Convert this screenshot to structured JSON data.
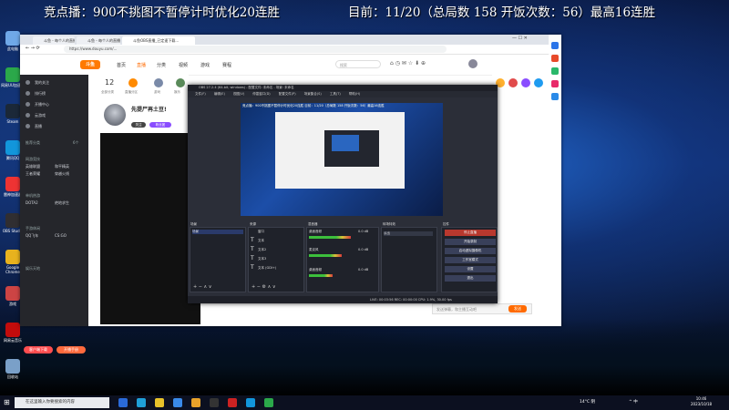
{
  "banner": {
    "left": "竞点播：900不挑图不暂停计时优化20连胜",
    "right": "目前：11/20（总局数 158 开饭次数：56）最高16连胜"
  },
  "desktop_icons": [
    {
      "label": "此电脑",
      "color": "#6fa8e8"
    },
    {
      "label": "网易UU加速器",
      "color": "#2ba84a"
    },
    {
      "label": "Steam",
      "color": "#1b2838"
    },
    {
      "label": "腾讯QQ",
      "color": "#1296db"
    },
    {
      "label": "雷神加速器",
      "color": "#e33"
    },
    {
      "label": "OBS Studio",
      "color": "#302e31"
    },
    {
      "label": "Google Chrome",
      "color": "#e8b21e"
    },
    {
      "label": "游戏",
      "color": "#c44"
    },
    {
      "label": "网易云音乐",
      "color": "#c20c0c"
    },
    {
      "label": "回收站",
      "color": "#7aa0c8"
    }
  ],
  "browser": {
    "tabs": [
      "斗鱼 - 每个人的直播平台",
      "斗鱼 - 每个人的直播平台",
      "斗鱼OBS直播_已定速下载..."
    ],
    "url": "https://www.douyu.com/...",
    "logo": "斗鱼",
    "nav": [
      "首页",
      "直播",
      "分类",
      "视频",
      "游戏",
      "赛程"
    ],
    "active_nav": "直播",
    "search_placeholder": "搜索",
    "window_controls": "—   ☐   ✕",
    "sidebar": {
      "items": [
        "我的关注",
        "排行榜",
        "开播中心",
        "云游戏",
        "直播"
      ],
      "sections": [
        {
          "title": "推荐分类",
          "count": "6个"
        },
        {
          "title": "网游竞技",
          "count": ""
        },
        {
          "title": "单机热游",
          "count": ""
        },
        {
          "title": "手游休闲",
          "count": ""
        },
        {
          "title": "娱乐天地",
          "count": ""
        }
      ],
      "games": [
        "英雄联盟",
        "和平精英",
        "王者荣耀",
        "穿越火线",
        "DOTA2",
        "绝地求生",
        "QQ飞车",
        "CS:GO"
      ],
      "btn_left": "客户端下载",
      "btn_right": "开播手册"
    },
    "categories": {
      "num": "12",
      "labels": [
        "全部分类",
        "直播分区",
        "游戏",
        "娱乐"
      ]
    },
    "streamer": {
      "name": "先提尸再土豆!",
      "badge1": "关注",
      "badge2": "粉丝团"
    },
    "chat_placeholder": "发送弹幕，和主播互动吧",
    "send": "发送"
  },
  "obs": {
    "title": "OBS 27.2.4 (64-bit, windows) - 配置文件: 未命名 - 场景: 未命名",
    "menu": [
      "文件(F)",
      "编辑(E)",
      "视图(V)",
      "停靠窗口(D)",
      "配置文件(P)",
      "场景集合(S)",
      "工具(T)",
      "帮助(H)"
    ],
    "preview_text": "竞点播：900不挑图不暂停计时优化20连胜    目前：11/20（总局数 158 开饭次数：56）最高16连胜",
    "docks": {
      "scenes": "场景",
      "sources": "来源",
      "mixer": "混音器",
      "transitions": "转场特效",
      "controls": "控件"
    },
    "scene_items": [
      "场景"
    ],
    "source_items": [
      "窗口",
      "文本",
      "文本2",
      "文本3",
      "文本 (GDI+)"
    ],
    "mixer": [
      {
        "name": "桌面音频",
        "db": "0.0 dB",
        "level": 0.62
      },
      {
        "name": "麦克风",
        "db": "0.0 dB",
        "level": 0.48
      },
      {
        "name": "桌面音频",
        "db": "0.0 dB",
        "level": 0.35
      }
    ],
    "transition": "淡出",
    "controls": [
      "停止直播",
      "开始录制",
      "启动虚拟摄像机",
      "工作室模式",
      "设置",
      "退出"
    ],
    "status": "LIVE: 00:03:56    REC: 00:00:00    CPU: 1.9%, 30.00 fps"
  },
  "taskbar": {
    "search": "在这里输入你要搜索的内容",
    "weather": "14°C 阴",
    "tray": "^  中",
    "time": "10:46",
    "date": "2023/10/18"
  }
}
